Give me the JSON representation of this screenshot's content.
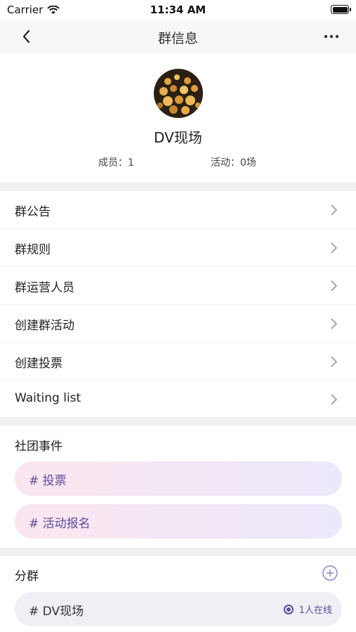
{
  "status_bar": {
    "carrier": "Carrier",
    "time": "11:34 AM"
  },
  "nav": {
    "title": "群信息"
  },
  "profile": {
    "name": "DV现场",
    "members": "成员：1",
    "activities": "活动：0场"
  },
  "menu": {
    "items": [
      {
        "label": "群公告"
      },
      {
        "label": "群规则"
      },
      {
        "label": "群运营人员"
      },
      {
        "label": "创建群活动"
      },
      {
        "label": "创建投票"
      },
      {
        "label": "Waiting list"
      }
    ]
  },
  "events": {
    "title": "社团事件",
    "items": [
      {
        "label": "# 投票"
      },
      {
        "label": "# 活动报名"
      }
    ]
  },
  "subgroups": {
    "title": "分群",
    "items": [
      {
        "label": "# DV现场",
        "online": "1人在线"
      }
    ]
  },
  "colors": {
    "accent": "#5b4d9c",
    "divider": "#f1f1f3"
  }
}
